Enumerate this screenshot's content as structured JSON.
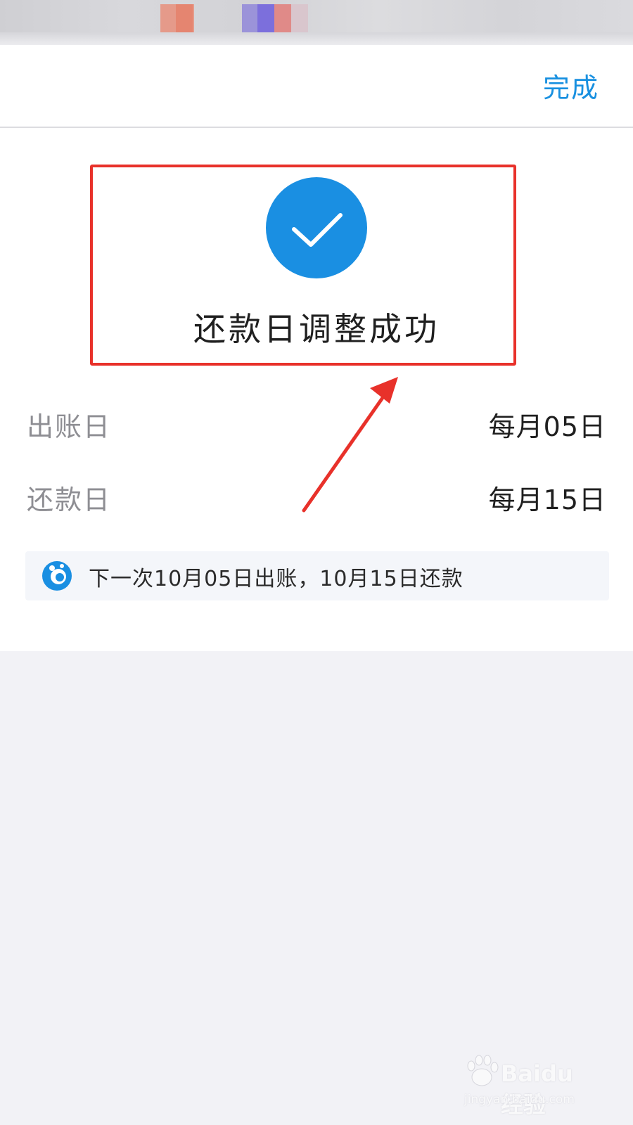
{
  "header": {
    "done_label": "完成"
  },
  "result": {
    "title": "还款日调整成功"
  },
  "details": {
    "billing_day": {
      "label": "出账日",
      "value": "每月05日"
    },
    "repayment_day": {
      "label": "还款日",
      "value": "每月15日"
    }
  },
  "notice": {
    "text": "下一次10月05日出账，10月15日还款"
  },
  "watermark": {
    "brand": "Baidu经验",
    "url": "jingyan.baidu.com"
  },
  "colors": {
    "accent": "#1890e0",
    "check_circle": "#1a8fe2",
    "annotation": "#e8312a"
  }
}
